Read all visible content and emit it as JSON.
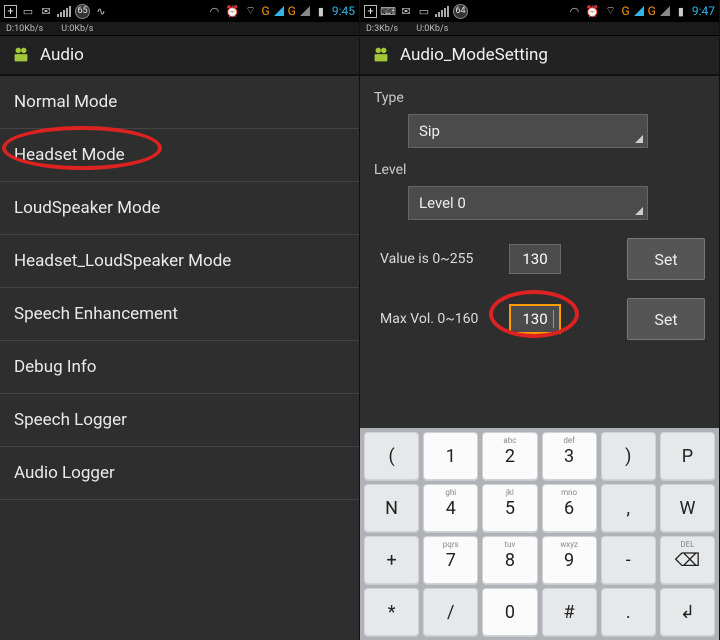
{
  "left": {
    "status": {
      "down": "D:10Kb/s",
      "up": "U:0Kb/s",
      "batt": "65",
      "time": "9:45",
      "g": "G"
    },
    "app_title": "Audio",
    "items": [
      "Normal Mode",
      "Headset Mode",
      "LoudSpeaker Mode",
      "Headset_LoudSpeaker Mode",
      "Speech Enhancement",
      "Debug Info",
      "Speech Logger",
      "Audio Logger"
    ]
  },
  "right": {
    "status": {
      "down": "D:3Kb/s",
      "up": "U:0Kb/s",
      "batt": "64",
      "time": "9:47",
      "g": "G"
    },
    "app_title": "Audio_ModeSetting",
    "type_label": "Type",
    "type_value": "Sip",
    "level_label": "Level",
    "level_value": "Level 0",
    "value_label": "Value is 0~255",
    "value_num": "130",
    "max_label": "Max Vol. 0~160",
    "max_num": "130",
    "set_label": "Set"
  },
  "keyboard": {
    "r1": [
      {
        "sub": "",
        "main": "("
      },
      {
        "sub": "",
        "main": "1"
      },
      {
        "sub": "abc",
        "main": "2"
      },
      {
        "sub": "def",
        "main": "3"
      },
      {
        "sub": "",
        "main": ")"
      },
      {
        "sub": "",
        "main": "P"
      }
    ],
    "r2": [
      {
        "sub": "",
        "main": "N"
      },
      {
        "sub": "ghi",
        "main": "4"
      },
      {
        "sub": "jkl",
        "main": "5"
      },
      {
        "sub": "mno",
        "main": "6"
      },
      {
        "sub": "",
        "main": ","
      },
      {
        "sub": "",
        "main": "W"
      }
    ],
    "r3": [
      {
        "sub": "",
        "main": "+"
      },
      {
        "sub": "pqrs",
        "main": "7"
      },
      {
        "sub": "tuv",
        "main": "8"
      },
      {
        "sub": "wxyz",
        "main": "9"
      },
      {
        "sub": "",
        "main": "-"
      },
      {
        "sub": "DEL",
        "main": "⌫"
      }
    ],
    "r4": [
      {
        "sub": "",
        "main": "*"
      },
      {
        "sub": "",
        "main": "/"
      },
      {
        "sub": "",
        "main": "0"
      },
      {
        "sub": "",
        "main": "#"
      },
      {
        "sub": "",
        "main": "."
      },
      {
        "sub": "",
        "main": "↲"
      }
    ]
  }
}
